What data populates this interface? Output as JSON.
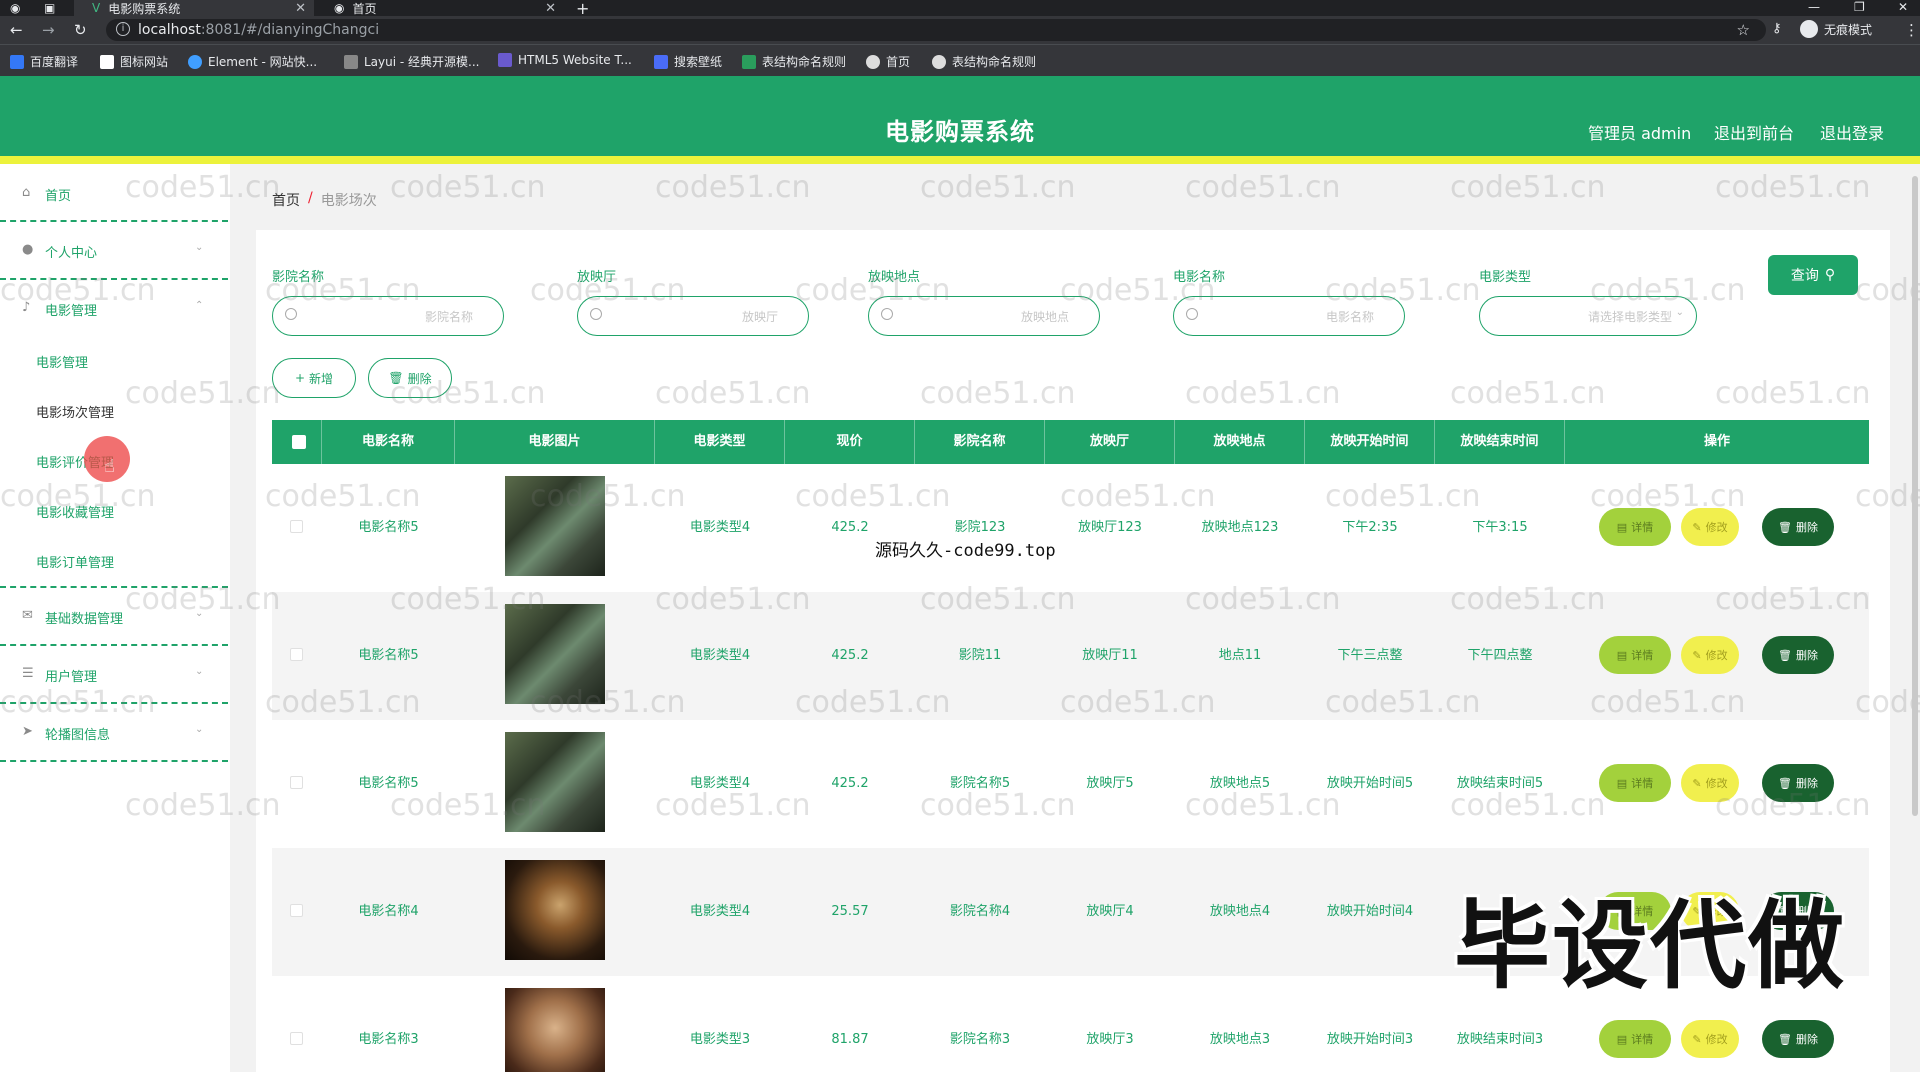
{
  "browser": {
    "tabs": [
      {
        "title": "电影购票系统",
        "active": true
      },
      {
        "title": "首页",
        "active": false
      }
    ],
    "new_tab": "+",
    "url_host": "localhost",
    "url_path": ":8081/#/dianyingChangci",
    "profile_label": "无痕模式",
    "bookmarks": [
      "百度翻译",
      "图标网站",
      "Element - 网站快...",
      "Layui - 经典开源模...",
      "HTML5 Website T...",
      "搜索壁纸",
      "表结构命名规则",
      "首页",
      "表结构命名规则"
    ]
  },
  "header": {
    "title": "电影购票系统",
    "admin_label": "管理员 admin",
    "back_label": "退出到前台",
    "logout_label": "退出登录"
  },
  "sidebar": {
    "home": "首页",
    "personal": "个人中心",
    "movie_mgmt": "电影管理",
    "sub_items": [
      "电影管理",
      "电影场次管理",
      "电影评价管理",
      "电影收藏管理",
      "电影订单管理"
    ],
    "basic_data": "基础数据管理",
    "user_mgmt": "用户管理",
    "carousel": "轮播图信息"
  },
  "breadcrumb": {
    "home": "首页",
    "sep": "/",
    "current": "电影场次"
  },
  "filters": [
    {
      "label": "影院名称",
      "placeholder": "影院名称"
    },
    {
      "label": "放映厅",
      "placeholder": "放映厅"
    },
    {
      "label": "放映地点",
      "placeholder": "放映地点"
    },
    {
      "label": "电影名称",
      "placeholder": "电影名称"
    },
    {
      "label": "电影类型",
      "placeholder": "请选择电影类型"
    }
  ],
  "buttons": {
    "query": "查询",
    "add": "新增",
    "delete": "删除"
  },
  "table": {
    "headers": [
      "电影名称",
      "电影图片",
      "电影类型",
      "现价",
      "影院名称",
      "放映厅",
      "放映地点",
      "放映开始时间",
      "放映结束时间",
      "操作"
    ],
    "action_labels": {
      "detail": "详情",
      "edit": "修改",
      "delete": "删除"
    },
    "rows": [
      {
        "name": "电影名称5",
        "type": "电影类型4",
        "price": "425.2",
        "cinema": "影院123",
        "hall": "放映厅123",
        "location": "放映地点123",
        "start": "下午2:35",
        "end": "下午3:15",
        "image": "crowd"
      },
      {
        "name": "电影名称5",
        "type": "电影类型4",
        "price": "425.2",
        "cinema": "影院11",
        "hall": "放映厅11",
        "location": "地点11",
        "start": "下午三点整",
        "end": "下午四点整",
        "image": "crowd"
      },
      {
        "name": "电影名称5",
        "type": "电影类型4",
        "price": "425.2",
        "cinema": "影院名称5",
        "hall": "放映厅5",
        "location": "放映地点5",
        "start": "放映开始时间5",
        "end": "放映结束时间5",
        "image": "crowd"
      },
      {
        "name": "电影名称4",
        "type": "电影类型4",
        "price": "25.57",
        "cinema": "影院名称4",
        "hall": "放映厅4",
        "location": "放映地点4",
        "start": "放映开始时间4",
        "end": "",
        "image": "clap"
      },
      {
        "name": "电影名称3",
        "type": "电影类型3",
        "price": "81.87",
        "cinema": "影院名称3",
        "hall": "放映厅3",
        "location": "放映地点3",
        "start": "放映开始时间3",
        "end": "放映结束时间3",
        "image": "face"
      }
    ]
  },
  "overlays": {
    "watermark": "code51.cn",
    "caption": "源码久久-code99.top",
    "stamp": "毕设代做"
  },
  "colors": {
    "primary": "#1fa369",
    "accent_bar": "#ecf23b",
    "detail": "#a3d13c",
    "edit": "#f1ef4e",
    "delete": "#19622f"
  }
}
